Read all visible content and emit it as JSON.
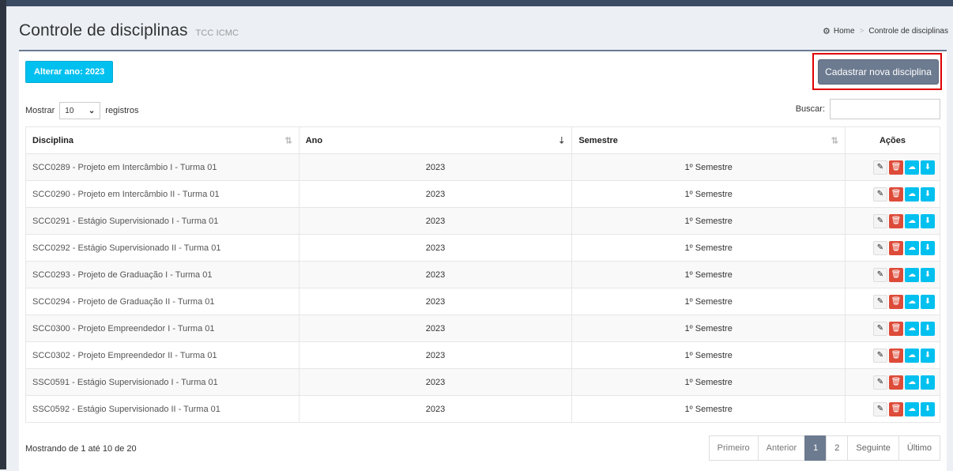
{
  "header": {
    "title": "Controle de disciplinas",
    "subtitle": "TCC ICMC",
    "breadcrumb": [
      "Home",
      "Controle de disciplinas"
    ]
  },
  "toolbar": {
    "year_button": "Alterar ano: 2023",
    "new_button": "Cadastrar nova disciplina"
  },
  "controls": {
    "show_label": "Mostrar",
    "length_value": "10",
    "records_label": "registros",
    "search_label": "Buscar:",
    "search_value": ""
  },
  "table": {
    "headers": [
      "Disciplina",
      "Ano",
      "Semestre",
      "Ações"
    ],
    "rows": [
      {
        "disciplina": "SCC0289 - Projeto em Intercâmbio I - Turma 01",
        "ano": "2023",
        "semestre": "1º Semestre"
      },
      {
        "disciplina": "SCC0290 - Projeto em Intercâmbio II - Turma 01",
        "ano": "2023",
        "semestre": "1º Semestre"
      },
      {
        "disciplina": "SCC0291 - Estágio Supervisionado I - Turma 01",
        "ano": "2023",
        "semestre": "1º Semestre"
      },
      {
        "disciplina": "SCC0292 - Estágio Supervisionado II - Turma 01",
        "ano": "2023",
        "semestre": "1º Semestre"
      },
      {
        "disciplina": "SCC0293 - Projeto de Graduação I - Turma 01",
        "ano": "2023",
        "semestre": "1º Semestre"
      },
      {
        "disciplina": "SCC0294 - Projeto de Graduação II - Turma 01",
        "ano": "2023",
        "semestre": "1º Semestre"
      },
      {
        "disciplina": "SCC0300 - Projeto Empreendedor I - Turma 01",
        "ano": "2023",
        "semestre": "1º Semestre"
      },
      {
        "disciplina": "SCC0302 - Projeto Empreendedor II - Turma 01",
        "ano": "2023",
        "semestre": "1º Semestre"
      },
      {
        "disciplina": "SSC0591 - Estágio Supervisionado I - Turma 01",
        "ano": "2023",
        "semestre": "1º Semestre"
      },
      {
        "disciplina": "SSC0592 - Estágio Supervisionado II - Turma 01",
        "ano": "2023",
        "semestre": "1º Semestre"
      }
    ],
    "row_actions": [
      "edit-icon",
      "trash-icon",
      "upload-icon",
      "download-icon"
    ]
  },
  "footer": {
    "info": "Mostrando de 1 até 10 de 20",
    "pagination": [
      "Primeiro",
      "Anterior",
      "1",
      "2",
      "Seguinte",
      "Último"
    ],
    "current_page": "1"
  },
  "colors": {
    "accent_cyan": "#00c0ef",
    "primary_gray": "#6d7b90",
    "danger_red": "#dd4b39",
    "highlight_red": "#e10000"
  }
}
